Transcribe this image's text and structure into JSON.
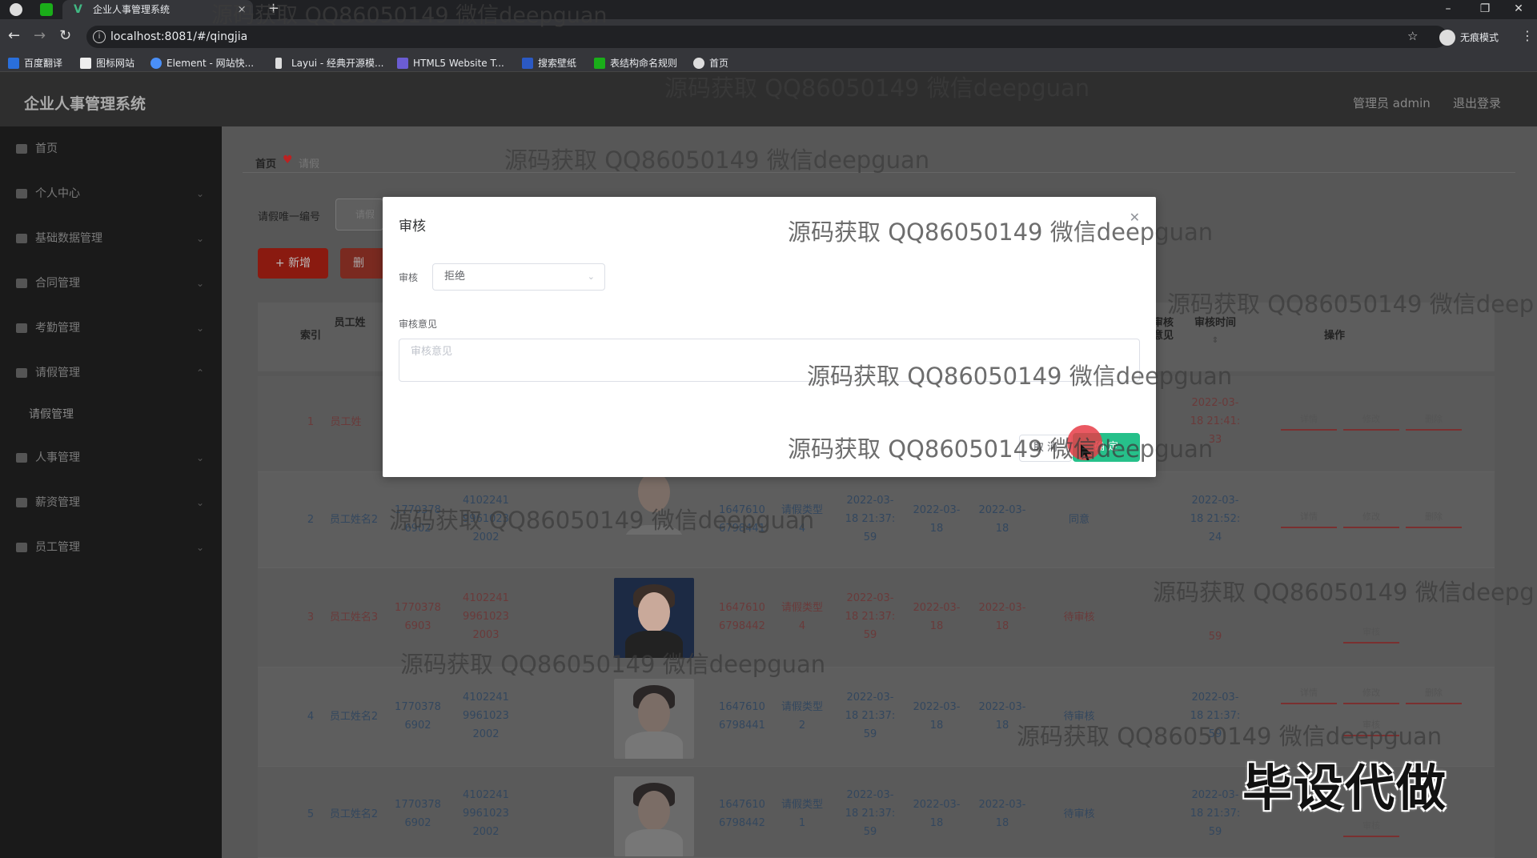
{
  "browser": {
    "tab_title": "企业人事管理系统",
    "url": "localhost:8081/#/qingjia",
    "incognito_label": "无痕模式",
    "bookmarks": [
      "百度翻译",
      "图标网站",
      "Element - 网站快...",
      "Layui - 经典开源模...",
      "HTML5 Website T...",
      "搜索壁纸",
      "表结构命名规则",
      "首页"
    ]
  },
  "header": {
    "app_title": "企业人事管理系统",
    "admin_label": "管理员 admin",
    "logout_label": "退出登录"
  },
  "sidebar": {
    "items": [
      "首页",
      "个人中心",
      "基础数据管理",
      "合同管理",
      "考勤管理",
      "请假管理",
      "请假管理",
      "人事管理",
      "薪资管理",
      "员工管理"
    ]
  },
  "main": {
    "breadcrumb_home": "首页",
    "breadcrumb_page": "请假",
    "search_label": "请假唯一编号",
    "search_placeholder": "请假",
    "add_button": "+ 新增",
    "delete_button": "删",
    "columns": [
      "索引",
      "员工姓",
      "审核意见",
      "审核时间",
      "操作"
    ],
    "rows": [
      {
        "index": "1",
        "name": "员工姓",
        "audit_time": "2022-03-\n18 21:41:\n33",
        "ops": [
          "详情",
          "修改",
          "删除"
        ]
      },
      {
        "index": "2",
        "name": "员工姓名2",
        "phone": "1770378\n6902",
        "idcard": "4102241\n9961023\n2002",
        "number": "1647610\n6798441",
        "type": "请假类型\n4",
        "time1": "2022-03-\n18 21:37:\n59",
        "date1": "2022-03-\n18",
        "date2": "2022-03-\n18",
        "status": "同意",
        "audit_time": "2022-03-\n18 21:52:\n24",
        "ops": [
          "详情",
          "修改",
          "删除"
        ]
      },
      {
        "index": "3",
        "name": "员工姓名3",
        "phone": "1770378\n6903",
        "idcard": "4102241\n9961023\n2003",
        "number": "1647610\n6798442",
        "type": "请假类型\n4",
        "time1": "2022-03-\n18 21:37:\n59",
        "date1": "2022-03-\n18",
        "date2": "2022-03-\n18",
        "status": "待审核",
        "audit_time": "59",
        "ops": [
          "审核"
        ]
      },
      {
        "index": "4",
        "name": "员工姓名2",
        "phone": "1770378\n6902",
        "idcard": "4102241\n9961023\n2002",
        "number": "1647610\n6798441",
        "type": "请假类型\n2",
        "time1": "2022-03-\n18 21:37:\n59",
        "date1": "2022-03-\n18",
        "date2": "2022-03-\n18",
        "status": "待审核",
        "audit_time": "2022-03-\n18 21:37:\n59",
        "ops": [
          "详情",
          "修改",
          "删除",
          "审核"
        ]
      },
      {
        "index": "5",
        "name": "员工姓名2",
        "phone": "1770378\n6902",
        "idcard": "4102241\n9961023\n2002",
        "number": "1647610\n6798442",
        "type": "请假类型\n1",
        "time1": "2022-03-\n18 21:37:\n59",
        "date1": "2022-03-\n18",
        "date2": "2022-03-\n18",
        "status": "待审核",
        "audit_time": "2022-03-\n18 21:37:\n59",
        "ops": [
          "审核"
        ]
      }
    ]
  },
  "modal": {
    "title": "审核",
    "audit_label": "审核",
    "audit_value": "拒绝",
    "opinion_label": "审核意见",
    "opinion_placeholder": "审核意见",
    "cancel_button": "取 消",
    "ok_button": "确 定"
  },
  "watermark": {
    "text": "源码获取 QQ86050149 微信deepguan",
    "text_cut": "源码获取 QQ86050149 微信deep",
    "text_cut2": "源码获取 QQ86050149 微信deepg",
    "big_text": "毕设代做"
  },
  "colors": {
    "primary_red": "#8a1a10",
    "confirm_green": "#26c08a"
  }
}
